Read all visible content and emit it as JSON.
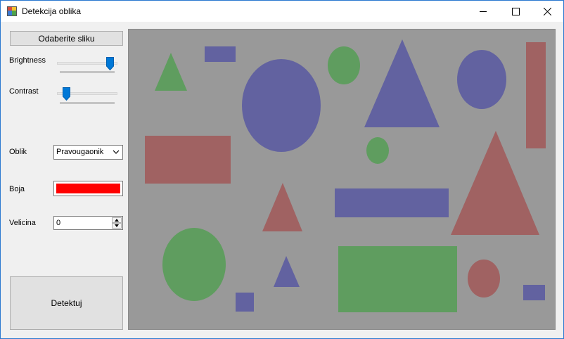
{
  "window": {
    "title": "Detekcija oblika"
  },
  "controls": {
    "select_image_label": "Odaberite sliku",
    "brightness_label": "Brightness",
    "brightness_value": 0.93,
    "contrast_label": "Contrast",
    "contrast_value": 0.08,
    "shape_label": "Oblik",
    "shape_value": "Pravougaonik",
    "color_label": "Boja",
    "color_value": "#ff0000",
    "size_label": "Velicina",
    "size_value": "0",
    "detect_label": "Detektuj"
  },
  "canvas": {
    "background": "#999999",
    "colors": {
      "green": "#5f9d5f",
      "blue": "#6262a0",
      "red": "#a06262"
    }
  },
  "icons": {
    "app": "app-icon",
    "minimize": "minimize-icon",
    "maximize": "maximize-icon",
    "close": "close-icon",
    "dropdown": "chevron-down-icon",
    "spin_up": "arrow-up-icon",
    "spin_down": "arrow-down-icon"
  }
}
